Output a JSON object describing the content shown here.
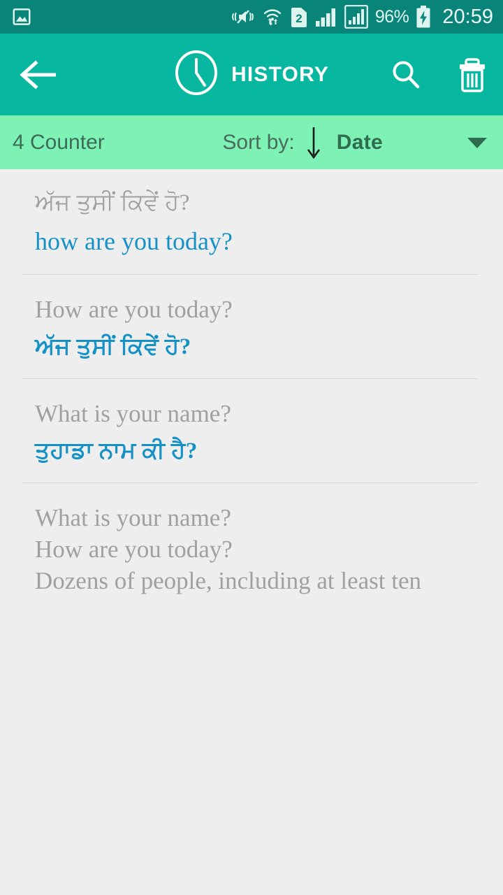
{
  "status_bar": {
    "icons": [
      "image-icon",
      "vibrate-mute-icon",
      "wifi-transfer-icon",
      "sim2-icon",
      "signal-bars-icon",
      "signal-bars-boxed-icon"
    ],
    "battery_percent": "96%",
    "battery_state_icon": "battery-charging-icon",
    "time": "20:59",
    "background_color": "#088578"
  },
  "app_bar": {
    "back_icon": "back-arrow-icon",
    "title_icon": "clock-icon",
    "title": "HISTORY",
    "search_icon": "search-icon",
    "delete_icon": "trash-icon",
    "background_color": "#08b79f"
  },
  "sort_bar": {
    "counter": "4 Counter",
    "sort_label": "Sort by:",
    "sort_direction_icon": "arrow-down-icon",
    "sort_value": "Date",
    "dropdown_icon": "chevron-down-icon",
    "background_color": "#7ef2b4",
    "options": [
      "Date"
    ]
  },
  "history_items": [
    {
      "source": "ਅੱਜ ਤੁਸੀਂ ਕਿਵੇਂ ਹੋ?",
      "source_script": "indic",
      "target": "how are you today?",
      "target_script": "latin"
    },
    {
      "source": "How are you today?",
      "source_script": "latin",
      "target": "ਅੱਜ ਤੁਸੀਂ ਕਿਵੇਂ ਹੋ?",
      "target_script": "indic"
    },
    {
      "source": "What is your name?",
      "source_script": "latin",
      "target": "ਤੁਹਾਡਾ ਨਾਮ ਕੀ ਹੈ?",
      "target_script": "indic"
    },
    {
      "source_line1": "What is your name?",
      "source_line2": "How are you today?",
      "source_line3": "Dozens of people, including at least ten",
      "source_script": "latin"
    }
  ],
  "colors": {
    "source_text": "#a0a0a0",
    "target_text": "#1591c6",
    "page_background": "#eeeeee",
    "divider": "#d6d6d6"
  }
}
